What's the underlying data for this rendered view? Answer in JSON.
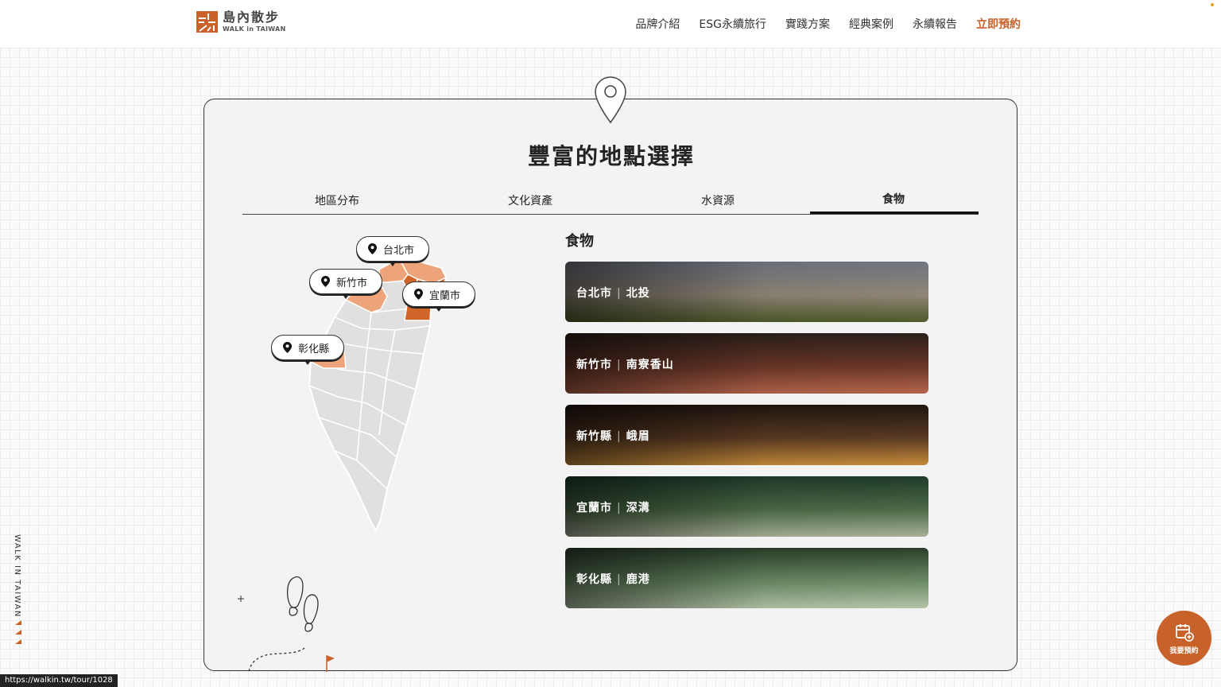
{
  "brand": {
    "name_cn": "島內散步",
    "name_en": "WALK in TAIWAN",
    "accent_color": "#c8622a"
  },
  "nav": {
    "items": [
      {
        "label": "品牌介紹"
      },
      {
        "label": "ESG永續旅行"
      },
      {
        "label": "實踐方案"
      },
      {
        "label": "經典案例"
      },
      {
        "label": "永續報告"
      }
    ],
    "cta": "立即預約"
  },
  "section": {
    "title": "豐富的地點選擇",
    "tabs": [
      {
        "label": "地區分布",
        "active": false
      },
      {
        "label": "文化資產",
        "active": false
      },
      {
        "label": "水資源",
        "active": false
      },
      {
        "label": "食物",
        "active": true
      }
    ],
    "heading": "食物"
  },
  "map": {
    "labels": [
      {
        "name": "台北市"
      },
      {
        "name": "新竹市"
      },
      {
        "name": "宜蘭市"
      },
      {
        "name": "彰化縣"
      }
    ],
    "highlight_colors": {
      "light": "#eda47a",
      "dark": "#d0652a",
      "base": "#e0e0e0"
    }
  },
  "list": [
    {
      "city": "台北市",
      "area": "北投",
      "palette": [
        "#6f7480",
        "#8f8576",
        "#4d5a2a"
      ]
    },
    {
      "city": "新竹市",
      "area": "南寮香山",
      "palette": [
        "#2a1f1a",
        "#6a3628",
        "#b4644a"
      ]
    },
    {
      "city": "新竹縣",
      "area": "峨眉",
      "palette": [
        "#1f1510",
        "#5a3a22",
        "#c48a3a"
      ]
    },
    {
      "city": "宜蘭市",
      "area": "深溝",
      "palette": [
        "#1e3a2a",
        "#4c6a46",
        "#a8b098"
      ]
    },
    {
      "city": "彰化縣",
      "area": "鹿港",
      "palette": [
        "#2a3e2a",
        "#6a8a64",
        "#b4c4a8"
      ]
    }
  ],
  "sidebar_text": "WALK IN TAIWAN",
  "status_url": "https://walkin.tw/tour/1028",
  "fab": {
    "label": "我要預約"
  }
}
